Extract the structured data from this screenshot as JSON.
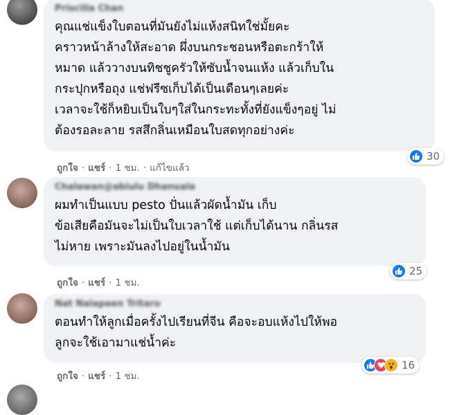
{
  "comments": [
    {
      "author": "Priscilla Chan",
      "text": "คุณแช่แข็งใบตอนที่มันยังไม่แห้งสนิทใช่มั้ยคะ\nคราวหน้าล้างให้สะอาด ผึ่งบนกระชอนหรือตะกร้าให้\nหมาด แล้ววางบนทิชชูครัวให้ซับน้ำจนแห้ง แล้วเก็บใน\nกระปุกหรือถุง แช่ฟรีซเก็บได้เป็นเดือนๆเลยค่ะ\nเวลาจะใช้ก็หยิบเป็นใบๆใส่ในกระทะทั้งที่ยังแข็งๆอยู่ ไม่\nต้องรอละลาย รสสึกลิ่นเหมือนใบสดทุกอย่างค่ะ",
      "like": "ถูกใจ",
      "reply": "แชร์",
      "time": "1 ชม.",
      "edited": "แก้ไขแล้ว",
      "reaction_count": "30",
      "reactions": [
        "like-icon"
      ]
    },
    {
      "author": "Chalawan@abiulu Dhanuala",
      "text": "ผมทำเป็นแบบ pesto ปั่นแล้วผัดน้ำมัน เก็บ\nข้อเสียคือมันจะไม่เป็นใบเวลาใช้ แต่เก็บได้นาน กลิ่นรส\nไม่หาย เพราะมันลงไปอยู่ในน้ำมัน",
      "like": "ถูกใจ",
      "reply": "แชร์",
      "time": "1 ชม.",
      "reaction_count": "25",
      "reactions": [
        "like-icon"
      ]
    },
    {
      "author": "Nat Nalapeen Tritaro",
      "text": "ตอนทำให้ลูกเมื่อครั้งไปเรียนที่จีน คือจะอบแห้งไปให้พอ\nลูกจะใช้เอามาแช่น้ำค่ะ",
      "like": "ถูกใจ",
      "reply": "แชร์",
      "time": "1 ชม.",
      "reaction_count": "16",
      "reactions": [
        "like-icon",
        "love-icon",
        "wow-icon"
      ]
    }
  ],
  "separator": "·",
  "colors": {
    "bubble": "#f0f2f5",
    "meta": "#65676b",
    "like": "#1877f2",
    "love": "#f33e58",
    "wow": "#f7b125"
  }
}
